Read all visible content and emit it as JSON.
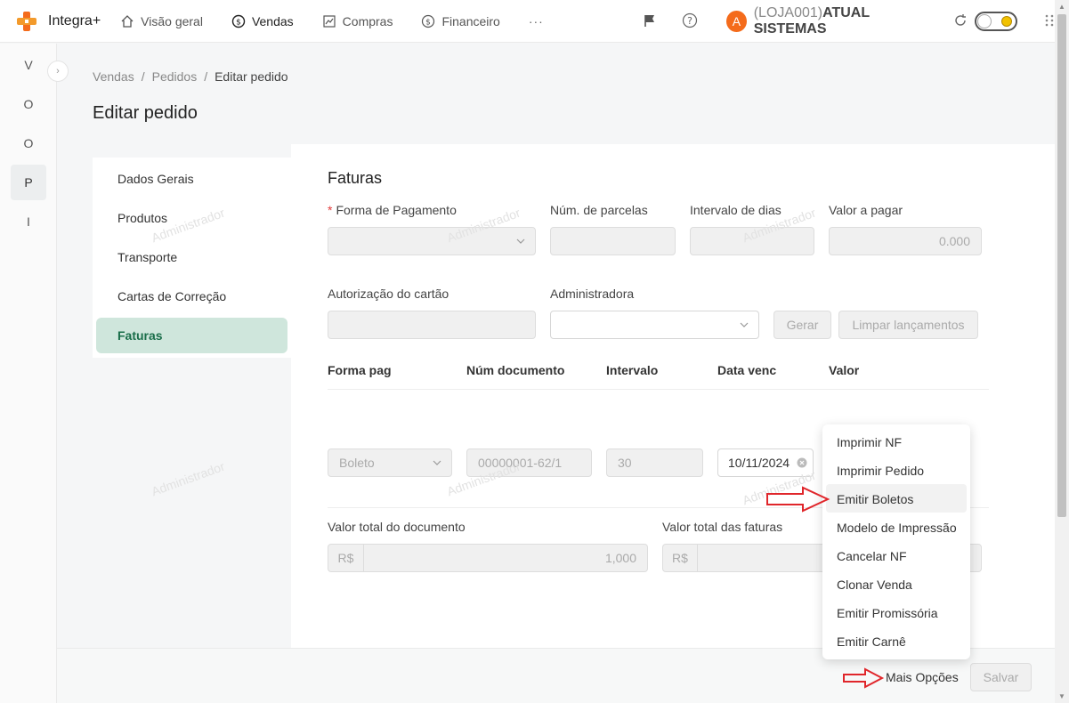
{
  "app": {
    "name": "Integra+"
  },
  "nav": {
    "items": [
      {
        "label": "Visão geral",
        "icon": "home-icon"
      },
      {
        "label": "Vendas",
        "icon": "dollar-icon"
      },
      {
        "label": "Compras",
        "icon": "chart-icon"
      },
      {
        "label": "Financeiro",
        "icon": "dollar-icon"
      }
    ],
    "more": "···"
  },
  "user": {
    "avatar_letter": "A",
    "store_code": "(LOJA001)",
    "store_name": "ATUAL SISTEMAS",
    "avatar_color": "#f46b1b"
  },
  "rail": {
    "items": [
      "V",
      "O",
      "O",
      "P",
      "I"
    ]
  },
  "breadcrumb": {
    "items": [
      "Vendas",
      "Pedidos",
      "Editar pedido"
    ],
    "sep": "/"
  },
  "page": {
    "title": "Editar pedido"
  },
  "side_menu": {
    "items": [
      "Dados Gerais",
      "Produtos",
      "Transporte",
      "Cartas de Correção",
      "Faturas"
    ],
    "active": "Faturas"
  },
  "faturas": {
    "title": "Faturas",
    "labels": {
      "forma_pagamento": "Forma de Pagamento",
      "num_parcelas": "Núm. de parcelas",
      "intervalo_dias": "Intervalo de dias",
      "valor_pagar": "Valor a pagar",
      "autorizacao": "Autorização do cartão",
      "administradora": "Administradora"
    },
    "required_mark": "*",
    "valor_pagar_value": "0.000",
    "buttons": {
      "gerar": "Gerar",
      "limpar": "Limpar lançamentos"
    },
    "table": {
      "headers": [
        "Forma pag",
        "Núm documento",
        "Intervalo",
        "Data venc",
        "Valor"
      ],
      "row": {
        "forma": "Boleto",
        "documento": "00000001-62/1",
        "intervalo": "30",
        "data_venc": "10/11/2024"
      }
    },
    "totals": {
      "documento_label": "Valor total do documento",
      "faturas_label": "Valor total das faturas",
      "currency": "R$",
      "documento_value": "1,000"
    }
  },
  "footer": {
    "mais_opcoes": "Mais Opções",
    "salvar": "Salvar"
  },
  "dropdown": {
    "items": [
      "Imprimir NF",
      "Imprimir Pedido",
      "Emitir Boletos",
      "Modelo de Impressão",
      "Cancelar NF",
      "Clonar Venda",
      "Emitir Promissória",
      "Emitir Carnê"
    ],
    "highlighted": "Emitir Boletos"
  },
  "watermark": "Administrador",
  "colors": {
    "accent_green": "#1a6e4a",
    "active_bg": "#cfe6dc",
    "arrow_red": "#e0262b"
  }
}
